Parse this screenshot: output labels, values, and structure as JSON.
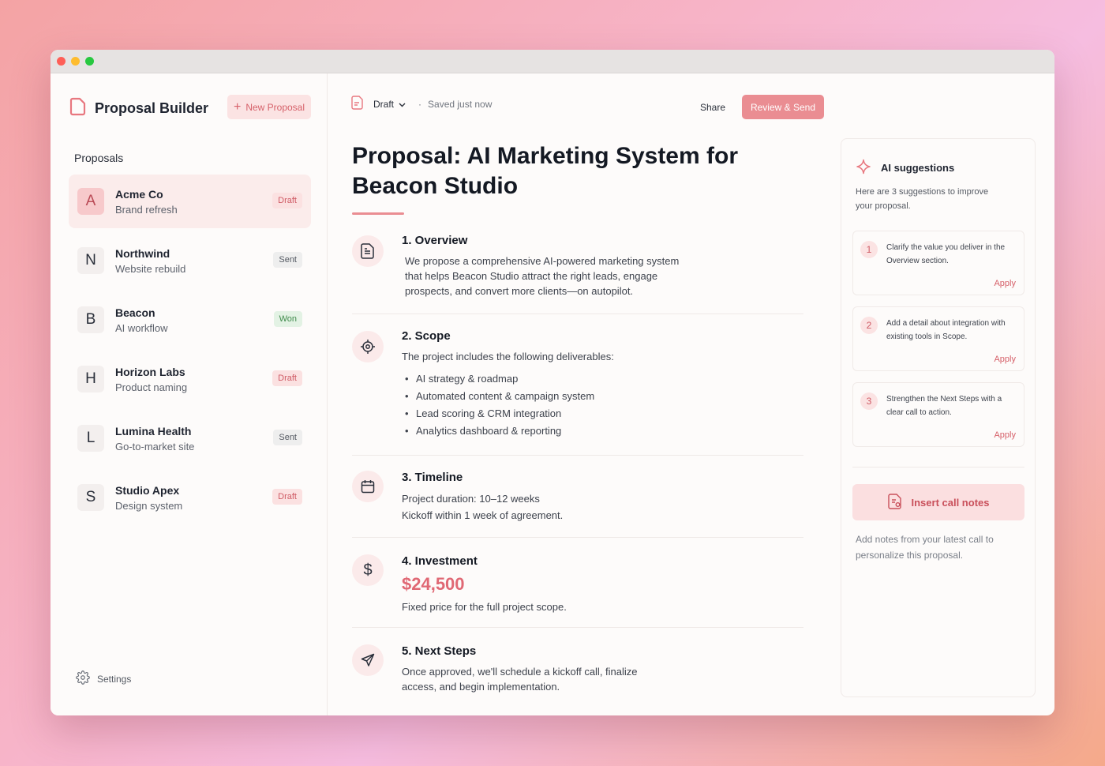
{
  "app": {
    "title": "Proposal Builder",
    "new_label": "New Proposal"
  },
  "sidebar": {
    "section_label": "Proposals",
    "items": [
      {
        "initial": "A",
        "name": "Acme Co",
        "sub": "Brand refresh",
        "status": "Draft"
      },
      {
        "initial": "N",
        "name": "Northwind",
        "sub": "Website rebuild",
        "status": "Sent"
      },
      {
        "initial": "B",
        "name": "Beacon",
        "sub": "AI workflow",
        "status": "Won"
      },
      {
        "initial": "H",
        "name": "Horizon Labs",
        "sub": "Product naming",
        "status": "Draft"
      },
      {
        "initial": "L",
        "name": "Lumina Health",
        "sub": "Go-to-market site",
        "status": "Sent"
      },
      {
        "initial": "S",
        "name": "Studio Apex",
        "sub": "Design system",
        "status": "Draft"
      }
    ],
    "settings_label": "Settings"
  },
  "toolbar": {
    "status": "Draft",
    "separator": "·",
    "saved": "Saved just now",
    "share": "Share",
    "review": "Review & Send"
  },
  "document": {
    "title": "Proposal: AI Marketing System for Beacon Studio",
    "overview": {
      "title": "1. Overview",
      "text": "We propose a comprehensive AI-powered marketing system that helps Beacon Studio attract the right leads, engage prospects, and convert more clients—on autopilot."
    },
    "scope": {
      "title": "2. Scope",
      "intro": "The project includes the following deliverables:",
      "bullets": [
        "AI strategy & roadmap",
        "Automated content & campaign system",
        "Lead scoring & CRM integration",
        "Analytics dashboard & reporting"
      ]
    },
    "timeline": {
      "title": "3. Timeline",
      "line1": "Project duration: 10–12 weeks",
      "line2": "Kickoff within 1 week of agreement."
    },
    "investment": {
      "title": "4. Investment",
      "price": "$24,500",
      "note": "Fixed price for the full project scope."
    },
    "next_steps": {
      "title": "5. Next Steps",
      "text": "Once approved, we'll schedule a kickoff call, finalize access, and begin implementation."
    }
  },
  "ai": {
    "title": "AI suggestions",
    "intro": "Here are 3 suggestions to improve your proposal.",
    "suggestions": [
      {
        "num": "1",
        "text": "Clarify the value you deliver in the Overview section.",
        "apply": "Apply"
      },
      {
        "num": "2",
        "text": "Add a detail about integration with existing tools in Scope.",
        "apply": "Apply"
      },
      {
        "num": "3",
        "text": "Strengthen the Next Steps with a clear call to action.",
        "apply": "Apply"
      }
    ],
    "insert_label": "Insert call notes",
    "insert_note": "Add notes from your latest call to personalize this proposal."
  },
  "colors": {
    "accent": "#ea8d92",
    "accent_text": "#d6616a",
    "price": "#e06874"
  }
}
